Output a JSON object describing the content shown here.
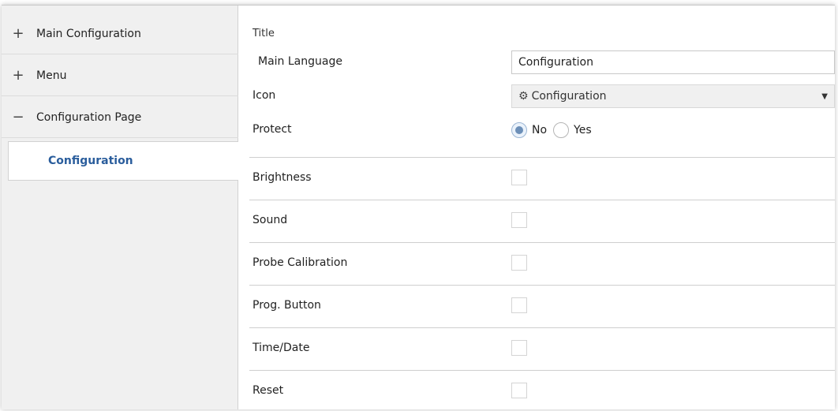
{
  "sidebar": {
    "items": [
      {
        "sign": "+",
        "label": "Main Configuration"
      },
      {
        "sign": "+",
        "label": "Menu"
      },
      {
        "sign": "−",
        "label": "Configuration Page"
      }
    ],
    "sub_item": {
      "label": "Configuration"
    }
  },
  "main": {
    "title_label": "Title",
    "main_language": {
      "label": "Main Language",
      "value": "Configuration"
    },
    "icon": {
      "label": "Icon",
      "icon_name": "gear-icon",
      "value": "Configuration"
    },
    "protect": {
      "label": "Protect",
      "options": [
        {
          "label": "No",
          "checked": true
        },
        {
          "label": "Yes",
          "checked": false
        }
      ]
    },
    "checkbox_rows": [
      {
        "label": "Brightness",
        "checked": false
      },
      {
        "label": "Sound",
        "checked": false
      },
      {
        "label": "Probe Calibration",
        "checked": false
      },
      {
        "label": "Prog. Button",
        "checked": false
      },
      {
        "label": "Time/Date",
        "checked": false
      },
      {
        "label": "Reset",
        "checked": false
      }
    ]
  },
  "colors": {
    "sidebar_bg": "#f0f0f0",
    "selected_text": "#2a5d9c",
    "radio_fill": "#6c8fb8"
  }
}
